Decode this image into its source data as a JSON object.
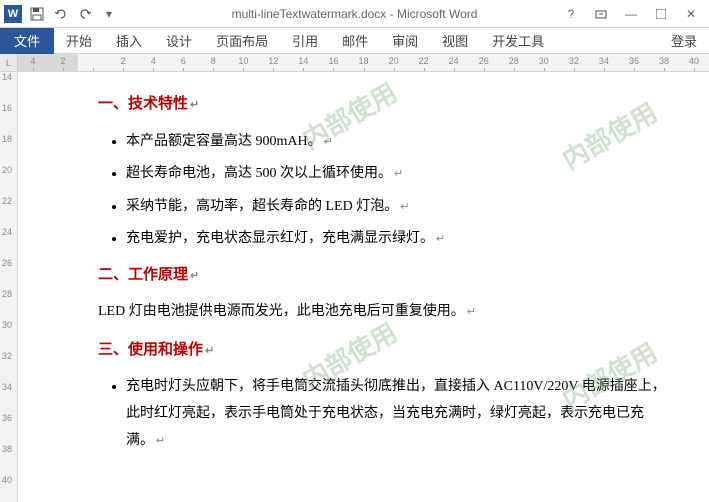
{
  "titlebar": {
    "app_icon": "W",
    "filename": "multi-lineTextwatermark.docx - Microsoft Word"
  },
  "tabs": {
    "file": "文件",
    "items": [
      "开始",
      "插入",
      "设计",
      "页面布局",
      "引用",
      "邮件",
      "审阅",
      "视图",
      "开发工具"
    ],
    "login": "登录"
  },
  "ruler_h": [
    "4",
    "2",
    "",
    "2",
    "4",
    "6",
    "8",
    "10",
    "12",
    "14",
    "16",
    "18",
    "20",
    "22",
    "24",
    "26",
    "28",
    "30",
    "32",
    "34",
    "36",
    "38",
    "40"
  ],
  "ruler_v": [
    "14",
    "16",
    "18",
    "20",
    "22",
    "24",
    "26",
    "28",
    "30",
    "32",
    "34",
    "36",
    "38",
    "40"
  ],
  "doc": {
    "h1": "一、技术特性",
    "list1": [
      "本产品额定容量高达 900mAH。",
      "超长寿命电池，高达 500 次以上循环使用。",
      "采纳节能，高功率，超长寿命的 LED 灯泡。",
      "充电爱护，充电状态显示红灯，充电满显示绿灯。"
    ],
    "h2": "二、工作原理",
    "p1": "LED 灯由电池提供电源而发光，此电池充电后可重复使用。",
    "h3": "三、使用和操作",
    "list2": [
      "充电时灯头应朝下，将手电筒交流插头彻底推出，直接插入 AC110V/220V 电源插座上，此时红灯亮起，表示手电筒处于充电状态，当充电充满时，绿灯亮起，表示充电已充满。"
    ],
    "watermark": "内部使用"
  }
}
